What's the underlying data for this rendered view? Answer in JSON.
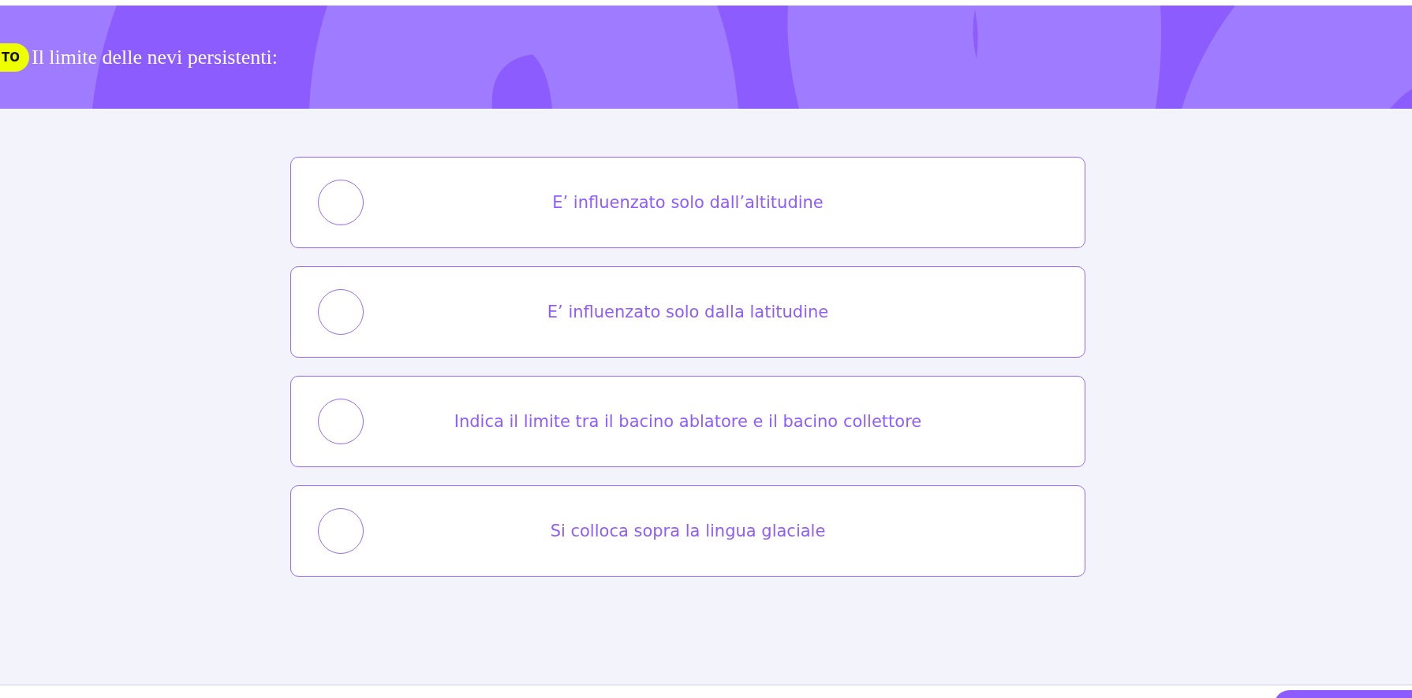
{
  "question": {
    "badge": "TO",
    "text": "Il limite delle nevi persistenti:"
  },
  "options": [
    {
      "label": "E’ influenzato solo dall’altitudine",
      "selected": false
    },
    {
      "label": "E’ influenzato solo dalla latitudine",
      "selected": false
    },
    {
      "label": "Indica il limite tra il bacino ablatore e il bacino collettore",
      "selected": false
    },
    {
      "label": "Si colloca sopra la lingua glaciale",
      "selected": false
    }
  ]
}
